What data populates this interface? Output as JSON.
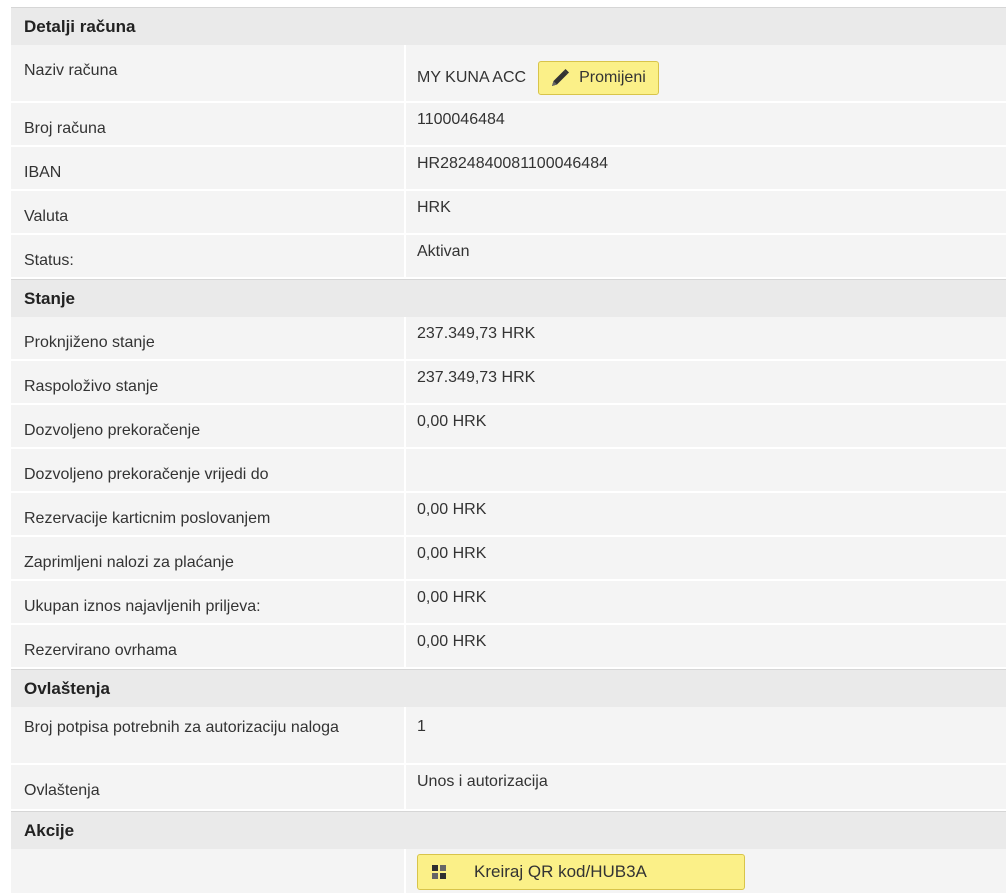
{
  "details": {
    "header": "Detalji računa",
    "rows": [
      {
        "label": "Naziv računa",
        "value": "MY KUNA ACC"
      },
      {
        "label": "Broj računa",
        "value": "1100046484"
      },
      {
        "label": "IBAN",
        "value": "HR2824840081100046484"
      },
      {
        "label": "Valuta",
        "value": "HRK"
      },
      {
        "label": "Status:",
        "value": "Aktivan"
      }
    ],
    "edit_button": {
      "label": "Promijeni",
      "icon": "pencil-icon"
    }
  },
  "balance": {
    "header": "Stanje",
    "rows": [
      {
        "label": "Proknjiženo stanje",
        "value": "237.349,73 HRK"
      },
      {
        "label": "Raspoloživo stanje",
        "value": "237.349,73 HRK"
      },
      {
        "label": "Dozvoljeno prekoračenje",
        "value": "0,00 HRK"
      },
      {
        "label": "Dozvoljeno prekoračenje vrijedi do",
        "value": ""
      },
      {
        "label": "Rezervacije karticnim poslovanjem",
        "value": "0,00 HRK"
      },
      {
        "label": "Zaprimljeni nalozi za plaćanje",
        "value": "0,00 HRK"
      },
      {
        "label": "Ukupan iznos najavljenih priljeva:",
        "value": "0,00 HRK"
      },
      {
        "label": "Rezervirano ovrhama",
        "value": "0,00 HRK"
      }
    ]
  },
  "authorizations": {
    "header": "Ovlaštenja",
    "rows": [
      {
        "label": "Broj potpisa potrebnih za autorizaciju naloga",
        "value": "1"
      },
      {
        "label": "Ovlaštenja",
        "value": "Unos i autorizacija"
      }
    ]
  },
  "actions": {
    "header": "Akcije",
    "qr_button": {
      "label": "Kreiraj QR kod/HUB3A",
      "icon": "qr-code-icon"
    }
  },
  "colors": {
    "section_header_bg": "#eaeaea",
    "row_bg": "#f4f4f4",
    "button_bg": "#fbf088",
    "button_border": "#d8c44a"
  }
}
